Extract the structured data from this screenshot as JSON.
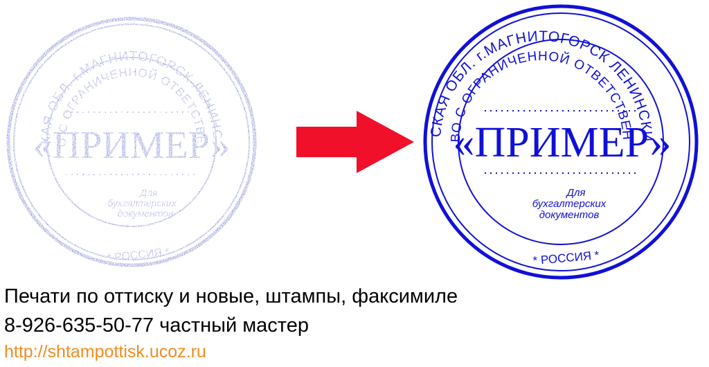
{
  "stamp": {
    "outer_text": "ЧЕЛЯБИНСКАЯ ОБЛ. г.МАГНИТОГОРСК ЛЕНИНСКИЙ РАЙОН",
    "inner_text": "ОБЩЕСТВО С ОГРАНИЧЕННОЙ ОТВЕТСТВЕННОСТЬЮ",
    "center_text": "«ПРИМЕР»",
    "sub_line1": "Для",
    "sub_line2": "бухгалтерских",
    "sub_line3": "документов",
    "bottom_text": "* РОССИЯ *"
  },
  "colors": {
    "old_stamp": "#5a62c8",
    "new_stamp": "#1010d8",
    "arrow": "#f0102a",
    "link": "#f08c1e"
  },
  "footer": {
    "line1": "Печати по оттиску и новые, штампы, факсимиле",
    "line2": "8-926-635-50-77 частный мастер",
    "link": "http://shtampottisk.ucoz.ru"
  }
}
